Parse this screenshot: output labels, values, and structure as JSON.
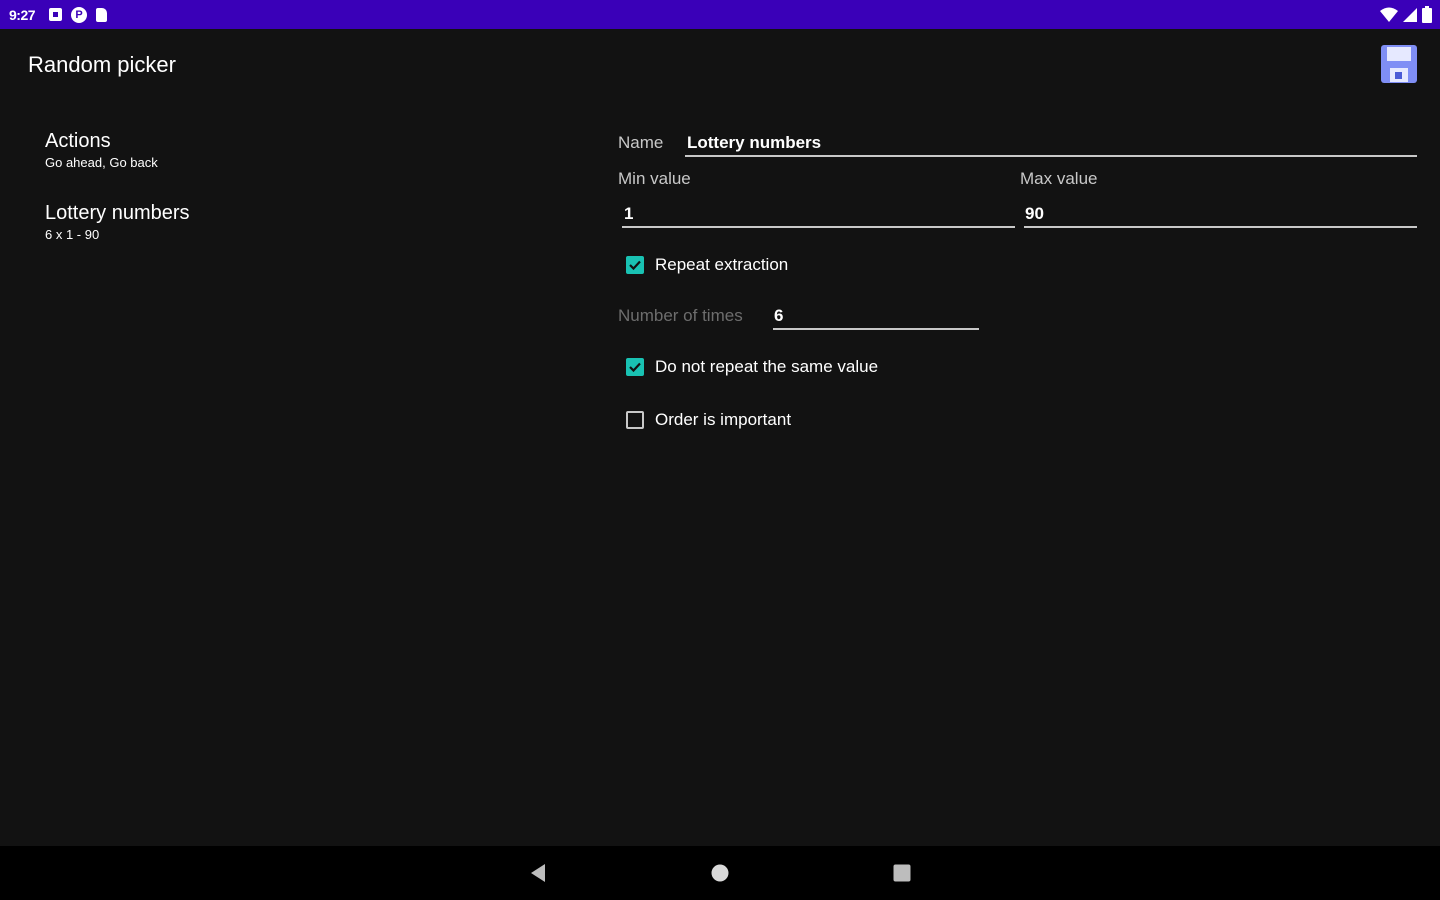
{
  "status_bar": {
    "time": "9:27",
    "background": "#3a00b8",
    "left_icons": [
      "notification-icon",
      "app-p-icon",
      "sd-card-icon"
    ],
    "right_icons": [
      "wifi-icon",
      "signal-icon",
      "battery-icon"
    ]
  },
  "app_bar": {
    "title": "Random picker",
    "save_icon": "floppy-disk-icon"
  },
  "list": {
    "items": [
      {
        "title": "Actions",
        "subtitle": "Go ahead, Go back"
      },
      {
        "title": "Lottery numbers",
        "subtitle": "6 x 1 - 90"
      }
    ]
  },
  "form": {
    "name_label": "Name",
    "name_value": "Lottery numbers",
    "min_label": "Min value",
    "min_value": "1",
    "max_label": "Max value",
    "max_value": "90",
    "repeat_extraction": {
      "label": "Repeat extraction",
      "checked": true
    },
    "times_label": "Number of times",
    "times_value": "6",
    "no_repeat_same": {
      "label": "Do not repeat the same value",
      "checked": true
    },
    "order_important": {
      "label": "Order is important",
      "checked": false
    }
  },
  "colors": {
    "accent": "#19c2b3",
    "background": "#121212",
    "status_bar": "#3a00b8",
    "nav_bar": "#000000"
  },
  "nav_bar": {
    "buttons": [
      "back-icon",
      "home-icon",
      "recents-icon"
    ]
  }
}
